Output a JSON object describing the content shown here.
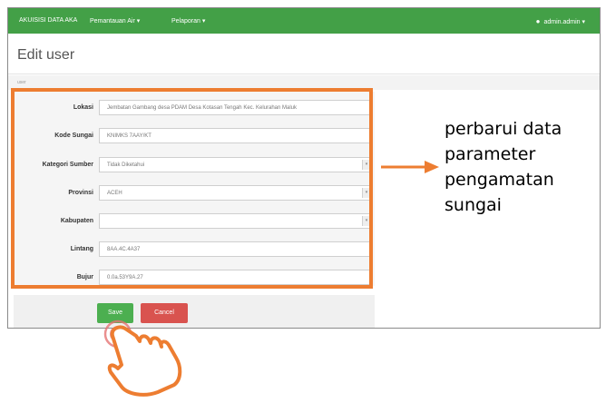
{
  "navbar": {
    "brand": "AKUISISI DATA AKA",
    "menu_1": "Pemantauan Air ▾",
    "menu_2": "Pelaporan ▾",
    "user": "admin.admin ▾"
  },
  "page": {
    "title": "Edit user",
    "breadcrumb": "user"
  },
  "form": {
    "fields": [
      {
        "label": "Lokasi",
        "value": "Jembatan Gambang desa PDAM Desa Kotasan Tengah Kec. Kelurahan Maluk"
      },
      {
        "label": "Kode Sungai",
        "value": "KNIMKS 7AAY/KT"
      },
      {
        "label": "Kategori Sumber",
        "value": "Tidak Diketahui"
      },
      {
        "label": "Provinsi",
        "value": "ACEH"
      },
      {
        "label": "Kabupaten",
        "value": ""
      },
      {
        "label": "Lintang",
        "value": "8AA.4C.4A37"
      },
      {
        "label": "Bujur",
        "value": "0.0a.53Y9A.27"
      }
    ],
    "save_label": "Save",
    "cancel_label": "Cancel"
  },
  "annotation": {
    "lines": [
      "perbarui data",
      "parameter",
      "pengamatan",
      "sungai"
    ],
    "highlight_color": "#ed7d31"
  },
  "icons": {
    "user": "user-icon",
    "hand": "hand-pointer-icon",
    "arrow": "arrow-right-icon"
  }
}
